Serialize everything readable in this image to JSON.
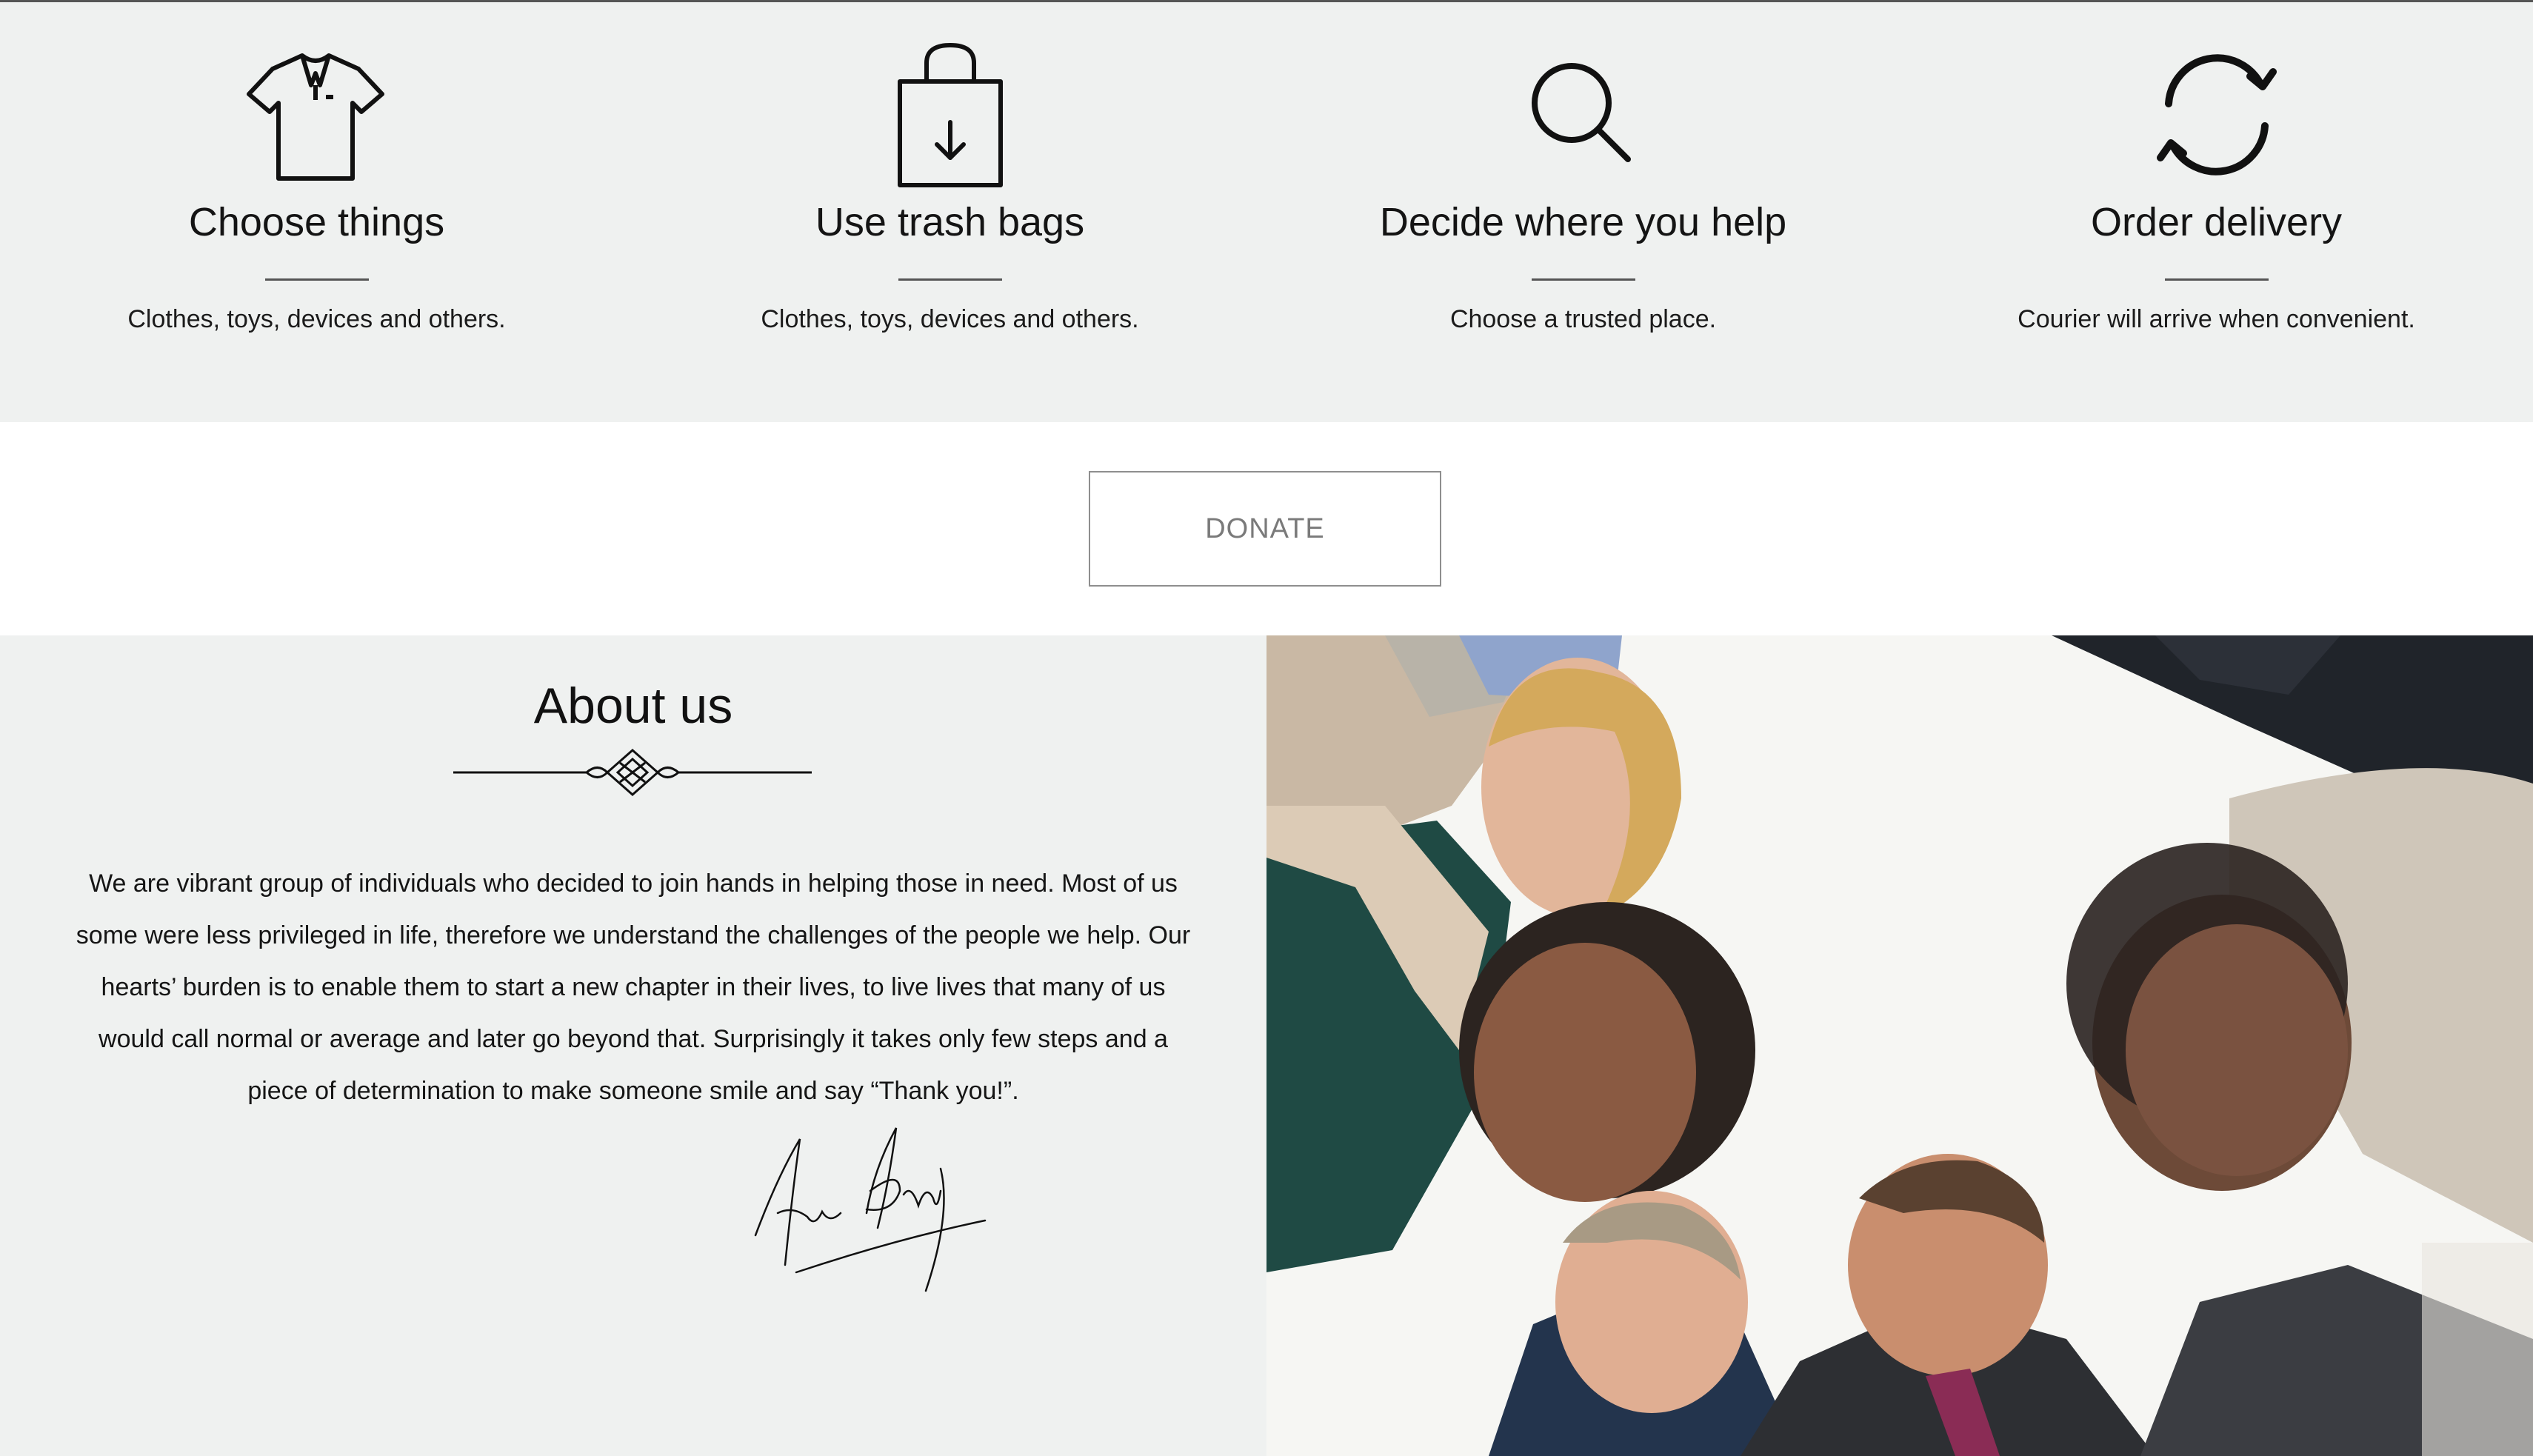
{
  "steps": [
    {
      "icon": "shirt-icon",
      "title": "Choose things",
      "desc": "Clothes, toys, devices and others."
    },
    {
      "icon": "shopping-bag-icon",
      "title": "Use trash bags",
      "desc": "Clothes, toys, devices and others."
    },
    {
      "icon": "search-icon",
      "title": "Decide where you help",
      "desc": "Choose a trusted place."
    },
    {
      "icon": "refresh-icon",
      "title": "Order delivery",
      "desc": "Courier will arrive when convenient."
    }
  ],
  "donate": {
    "label": "DONATE"
  },
  "about": {
    "title": "About us",
    "text": "We are vibrant group of individuals who decided to join hands in helping those in need. Most of us some were less privileged in life, therefore we understand the challenges of the people we help. Our hearts’ burden is to enable them to start a new chapter in their lives, to live lives that many of us would call normal or average and later go beyond that. Surprisingly it takes only few steps and a piece of determination to make someone smile and say “Thank you!”."
  },
  "colors": {
    "section_bg": "#eff1f0",
    "divider": "#555555",
    "button_border": "#8e8e8e",
    "button_text": "#7a7a7a"
  }
}
